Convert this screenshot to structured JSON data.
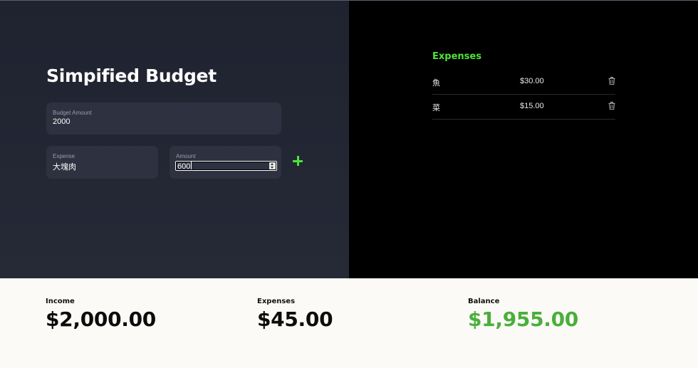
{
  "app": {
    "title": "Simpified Budget"
  },
  "form": {
    "budget": {
      "label": "Budget Amount",
      "value": "2000"
    },
    "expense": {
      "label": "Expense",
      "value": "大塊肉"
    },
    "amount": {
      "label": "Amount",
      "value": "600"
    },
    "add_icon": "plus-icon"
  },
  "expenses": {
    "heading": "Expenses",
    "items": [
      {
        "name": "魚",
        "amount": "$30.00",
        "delete_icon": "trash-icon"
      },
      {
        "name": "菜",
        "amount": "$15.00",
        "delete_icon": "trash-icon"
      }
    ]
  },
  "summary": {
    "income": {
      "label": "Income",
      "value": "$2,000.00"
    },
    "expenses": {
      "label": "Expenses",
      "value": "$45.00"
    },
    "balance": {
      "label": "Balance",
      "value": "$1,955.00"
    }
  },
  "colors": {
    "accent_green": "#4ee33a",
    "balance_green": "#4aaf3b",
    "left_panel_bg": "#232734",
    "right_panel_bg": "#000000",
    "summary_bg": "#fbfaf6"
  }
}
